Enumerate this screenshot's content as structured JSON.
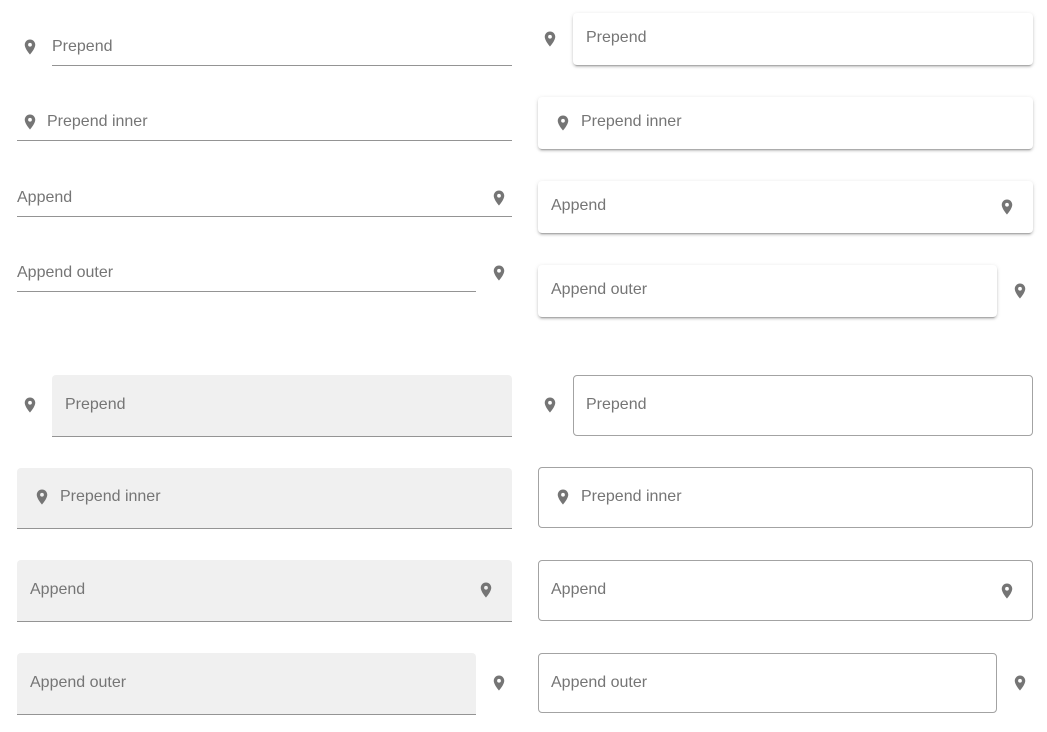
{
  "icon": {
    "name": "map-marker-icon",
    "color": "#757575"
  },
  "standard": {
    "prepend": "Prepend",
    "prepend_inner": "Prepend inner",
    "append": "Append",
    "append_outer": "Append outer"
  },
  "solo": {
    "prepend": "Prepend",
    "prepend_inner": "Prepend inner",
    "append": "Append",
    "append_outer": "Append outer"
  },
  "filled": {
    "prepend": "Prepend",
    "prepend_inner": "Prepend inner",
    "append": "Append",
    "append_outer": "Append outer"
  },
  "outlined": {
    "prepend": "Prepend",
    "prepend_inner": "Prepend inner",
    "append": "Append",
    "append_outer": "Append outer"
  }
}
